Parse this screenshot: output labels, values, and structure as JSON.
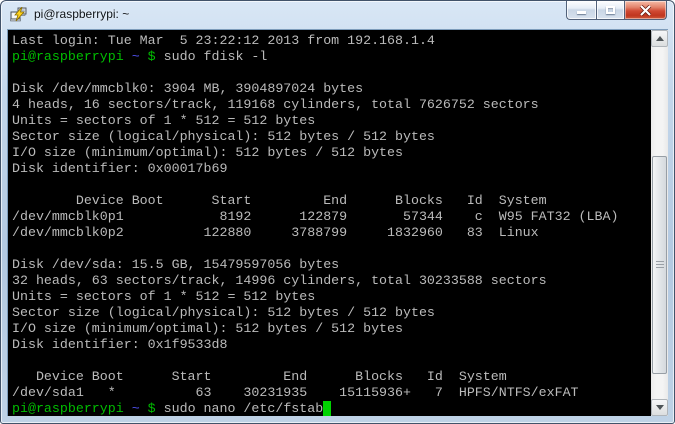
{
  "window": {
    "title": "pi@raspberrypi: ~",
    "icons": {
      "app": "putty-icon",
      "minimize": "—",
      "maximize": "□",
      "close": "✕",
      "scroll_up": "▲",
      "scroll_down": "▼"
    }
  },
  "terminal": {
    "colors": {
      "bg": "#000000",
      "fg": "#bbbbbb",
      "green": "#00bd00",
      "blue": "#5151f2",
      "cursor": "#00d300"
    },
    "lines": [
      {
        "s": [
          [
            "fg",
            "Last login: Tue Mar  5 23:22:12 2013 from 192.168.1.4"
          ]
        ]
      },
      {
        "s": [
          [
            "green",
            "pi@raspberrypi"
          ],
          [
            "fg",
            " "
          ],
          [
            "blue",
            "~"
          ],
          [
            "fg",
            " "
          ],
          [
            "green",
            "$"
          ],
          [
            "fg",
            " sudo fdisk -l"
          ]
        ]
      },
      {
        "s": []
      },
      {
        "s": [
          [
            "fg",
            "Disk /dev/mmcblk0: 3904 MB, 3904897024 bytes"
          ]
        ]
      },
      {
        "s": [
          [
            "fg",
            "4 heads, 16 sectors/track, 119168 cylinders, total 7626752 sectors"
          ]
        ]
      },
      {
        "s": [
          [
            "fg",
            "Units = sectors of 1 * 512 = 512 bytes"
          ]
        ]
      },
      {
        "s": [
          [
            "fg",
            "Sector size (logical/physical): 512 bytes / 512 bytes"
          ]
        ]
      },
      {
        "s": [
          [
            "fg",
            "I/O size (minimum/optimal): 512 bytes / 512 bytes"
          ]
        ]
      },
      {
        "s": [
          [
            "fg",
            "Disk identifier: 0x00017b69"
          ]
        ]
      },
      {
        "s": []
      },
      {
        "s": [
          [
            "fg",
            "        Device Boot      Start         End      Blocks   Id  System"
          ]
        ]
      },
      {
        "s": [
          [
            "fg",
            "/dev/mmcblk0p1            8192      122879       57344    c  W95 FAT32 (LBA)"
          ]
        ]
      },
      {
        "s": [
          [
            "fg",
            "/dev/mmcblk0p2          122880     3788799     1832960   83  Linux"
          ]
        ]
      },
      {
        "s": []
      },
      {
        "s": [
          [
            "fg",
            "Disk /dev/sda: 15.5 GB, 15479597056 bytes"
          ]
        ]
      },
      {
        "s": [
          [
            "fg",
            "32 heads, 63 sectors/track, 14996 cylinders, total 30233588 sectors"
          ]
        ]
      },
      {
        "s": [
          [
            "fg",
            "Units = sectors of 1 * 512 = 512 bytes"
          ]
        ]
      },
      {
        "s": [
          [
            "fg",
            "Sector size (logical/physical): 512 bytes / 512 bytes"
          ]
        ]
      },
      {
        "s": [
          [
            "fg",
            "I/O size (minimum/optimal): 512 bytes / 512 bytes"
          ]
        ]
      },
      {
        "s": [
          [
            "fg",
            "Disk identifier: 0x1f9533d8"
          ]
        ]
      },
      {
        "s": []
      },
      {
        "s": [
          [
            "fg",
            "   Device Boot      Start         End      Blocks   Id  System"
          ]
        ]
      },
      {
        "s": [
          [
            "fg",
            "/dev/sda1   *          63    30231935    15115936+   7  HPFS/NTFS/exFAT"
          ]
        ]
      },
      {
        "s": [
          [
            "green",
            "pi@raspberrypi"
          ],
          [
            "fg",
            " "
          ],
          [
            "blue",
            "~"
          ],
          [
            "fg",
            " "
          ],
          [
            "green",
            "$"
          ],
          [
            "fg",
            " sudo nano /etc/fstab"
          ],
          [
            "cursor",
            " "
          ]
        ]
      }
    ]
  },
  "scrollbar": {
    "thumb_top_pct": 31,
    "thumb_height_pct": 62
  }
}
